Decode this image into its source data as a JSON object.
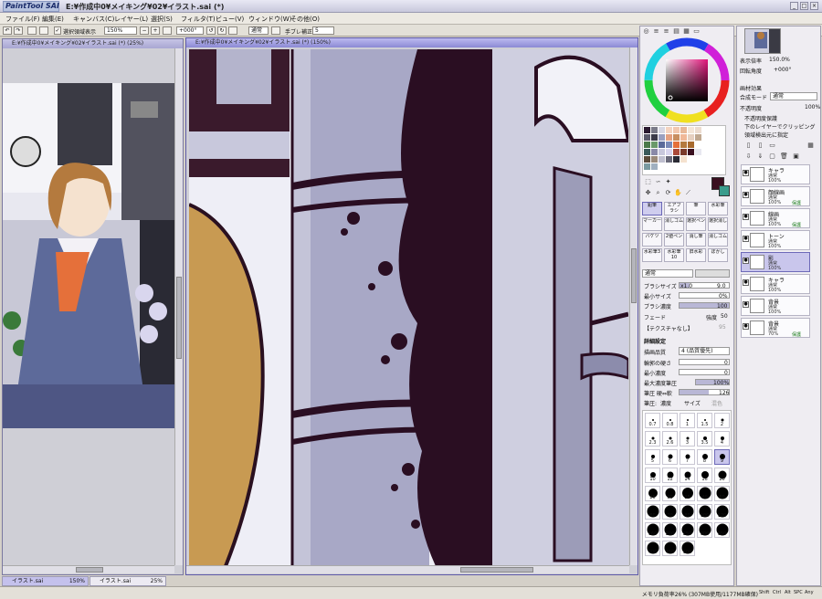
{
  "app": {
    "logo": "PaintTool SAI",
    "title": "E:¥作成中0¥メイキング¥02¥イラスト.sai (*)",
    "window_controls": [
      "_",
      "□",
      "×"
    ]
  },
  "menu": [
    "ファイル(F)",
    "編集(E)",
    "キャンバス(C)",
    "レイヤー(L)",
    "選択(S)",
    "フィルタ(T)",
    "ビュー(V)",
    "ウィンドウ(W)",
    "その他(O)"
  ],
  "toolbar": {
    "checkbox_label": "選択領域表示",
    "zoom": "150%",
    "rotation": "+000°",
    "blend": "通常",
    "stabilizer_label": "手ブレ補正",
    "stabilizer_value": "5"
  },
  "canvas_windows": {
    "small": {
      "title": "E:¥作成中0¥メイキング¥02¥イラスト.sai (*) (25%)"
    },
    "main": {
      "title": "E:¥作成中0¥メイキング¥02¥イラスト.sai (*) (150%)"
    }
  },
  "doc_tabs": [
    {
      "name": "イラスト.sai",
      "zoom": "150%"
    },
    {
      "name": "イラスト.sai",
      "zoom": "25%"
    }
  ],
  "status": {
    "memory": "メモリ負荷率26% (307MB使用/1177MB確保)",
    "keys": [
      "Shift",
      "Ctrl",
      "Alt",
      "SPC",
      "Any"
    ]
  },
  "colors": {
    "current": "#3a1020",
    "secondary": "#3a9c8c",
    "accent": "#8c8ad4"
  },
  "navigator": {
    "zoom_label": "表示倍率",
    "zoom_value": "150.0%",
    "angle_label": "回転角度",
    "angle_value": "+000°"
  },
  "layer_props": {
    "effect_label": "画材効果",
    "mode_label": "合成モード",
    "mode_value": "通常",
    "opacity_label": "不透明度",
    "opacity_value": "100%",
    "checks": [
      "不透明度保護",
      "下のレイヤーでクリッピング",
      "領域検出元に指定"
    ]
  },
  "layers": [
    {
      "name": "キャラ",
      "mode": "通常",
      "opacity": "100%",
      "folder": true,
      "protect": ""
    },
    {
      "name": "顔線画",
      "mode": "通常",
      "opacity": "100%",
      "folder": false,
      "protect": "保護"
    },
    {
      "name": "線画",
      "mode": "通常",
      "opacity": "100%",
      "folder": false,
      "protect": "保護"
    },
    {
      "name": "トーン",
      "mode": "通常",
      "opacity": "100%",
      "folder": false,
      "protect": ""
    },
    {
      "name": "影",
      "mode": "通常",
      "opacity": "100%",
      "folder": false,
      "protect": "",
      "selected": true
    },
    {
      "name": "キャラ",
      "mode": "通常",
      "opacity": "100%",
      "folder": true,
      "protect": ""
    },
    {
      "name": "背景",
      "mode": "通常",
      "opacity": "100%",
      "folder": true,
      "protect": ""
    },
    {
      "name": "背景",
      "mode": "通常",
      "opacity": "70%",
      "folder": false,
      "protect": "保護"
    }
  ],
  "tools": [
    "鉛筆",
    "エアブラシ",
    "筆",
    "水彩筆",
    "マーカー",
    "消しゴム",
    "選択ペン",
    "選択消し",
    "バケツ",
    "2値ペン",
    "消し筆",
    "消しゴム",
    "水彩筆3",
    "水彩筆10",
    "旧水彩",
    "ぼかし"
  ],
  "tool_options": {
    "mode": "通常",
    "brush_size_label": "ブラシサイズ",
    "brush_size_mult": "x1.0",
    "brush_size_value": "9.0",
    "min_size_label": "最小サイズ",
    "min_size_value": "0%",
    "density_label": "ブラシ濃度",
    "density_value": "100",
    "fade_label": "フェード",
    "fade_mode": "強度",
    "fade_value": "50",
    "texture_label": "【テクスチャなし】",
    "texture_value": "95",
    "detail_label": "詳細設定",
    "quality_label": "描画品質",
    "quality_value": "4 (品質優先)",
    "edge_label": "輪郭の硬さ",
    "edge_value": "0",
    "min_density_label": "最小濃度",
    "min_density_value": "0",
    "max_pressure_label": "最大濃度筆圧",
    "max_pressure_value": "100%",
    "hard_soft_label": "筆圧 硬⇔軟",
    "hard_soft_value": "126",
    "pressure_label": "筆圧:",
    "pressure_density": "濃度",
    "pressure_size": "サイズ",
    "pressure_blend": "混色"
  },
  "brush_sizes": [
    "0.7",
    "0.8",
    "1",
    "1.5",
    "2",
    "2.3",
    "2.6",
    "3",
    "3.5",
    "4",
    "5",
    "6",
    "7",
    "8",
    "9",
    "10",
    "12",
    "14",
    "16",
    "20",
    "25",
    "30",
    "35",
    "40",
    "50",
    "60",
    "70",
    "80",
    "100",
    "120",
    "160",
    "200",
    "250",
    "300",
    "350",
    "400",
    "450",
    "500"
  ],
  "brush_selected": "9"
}
